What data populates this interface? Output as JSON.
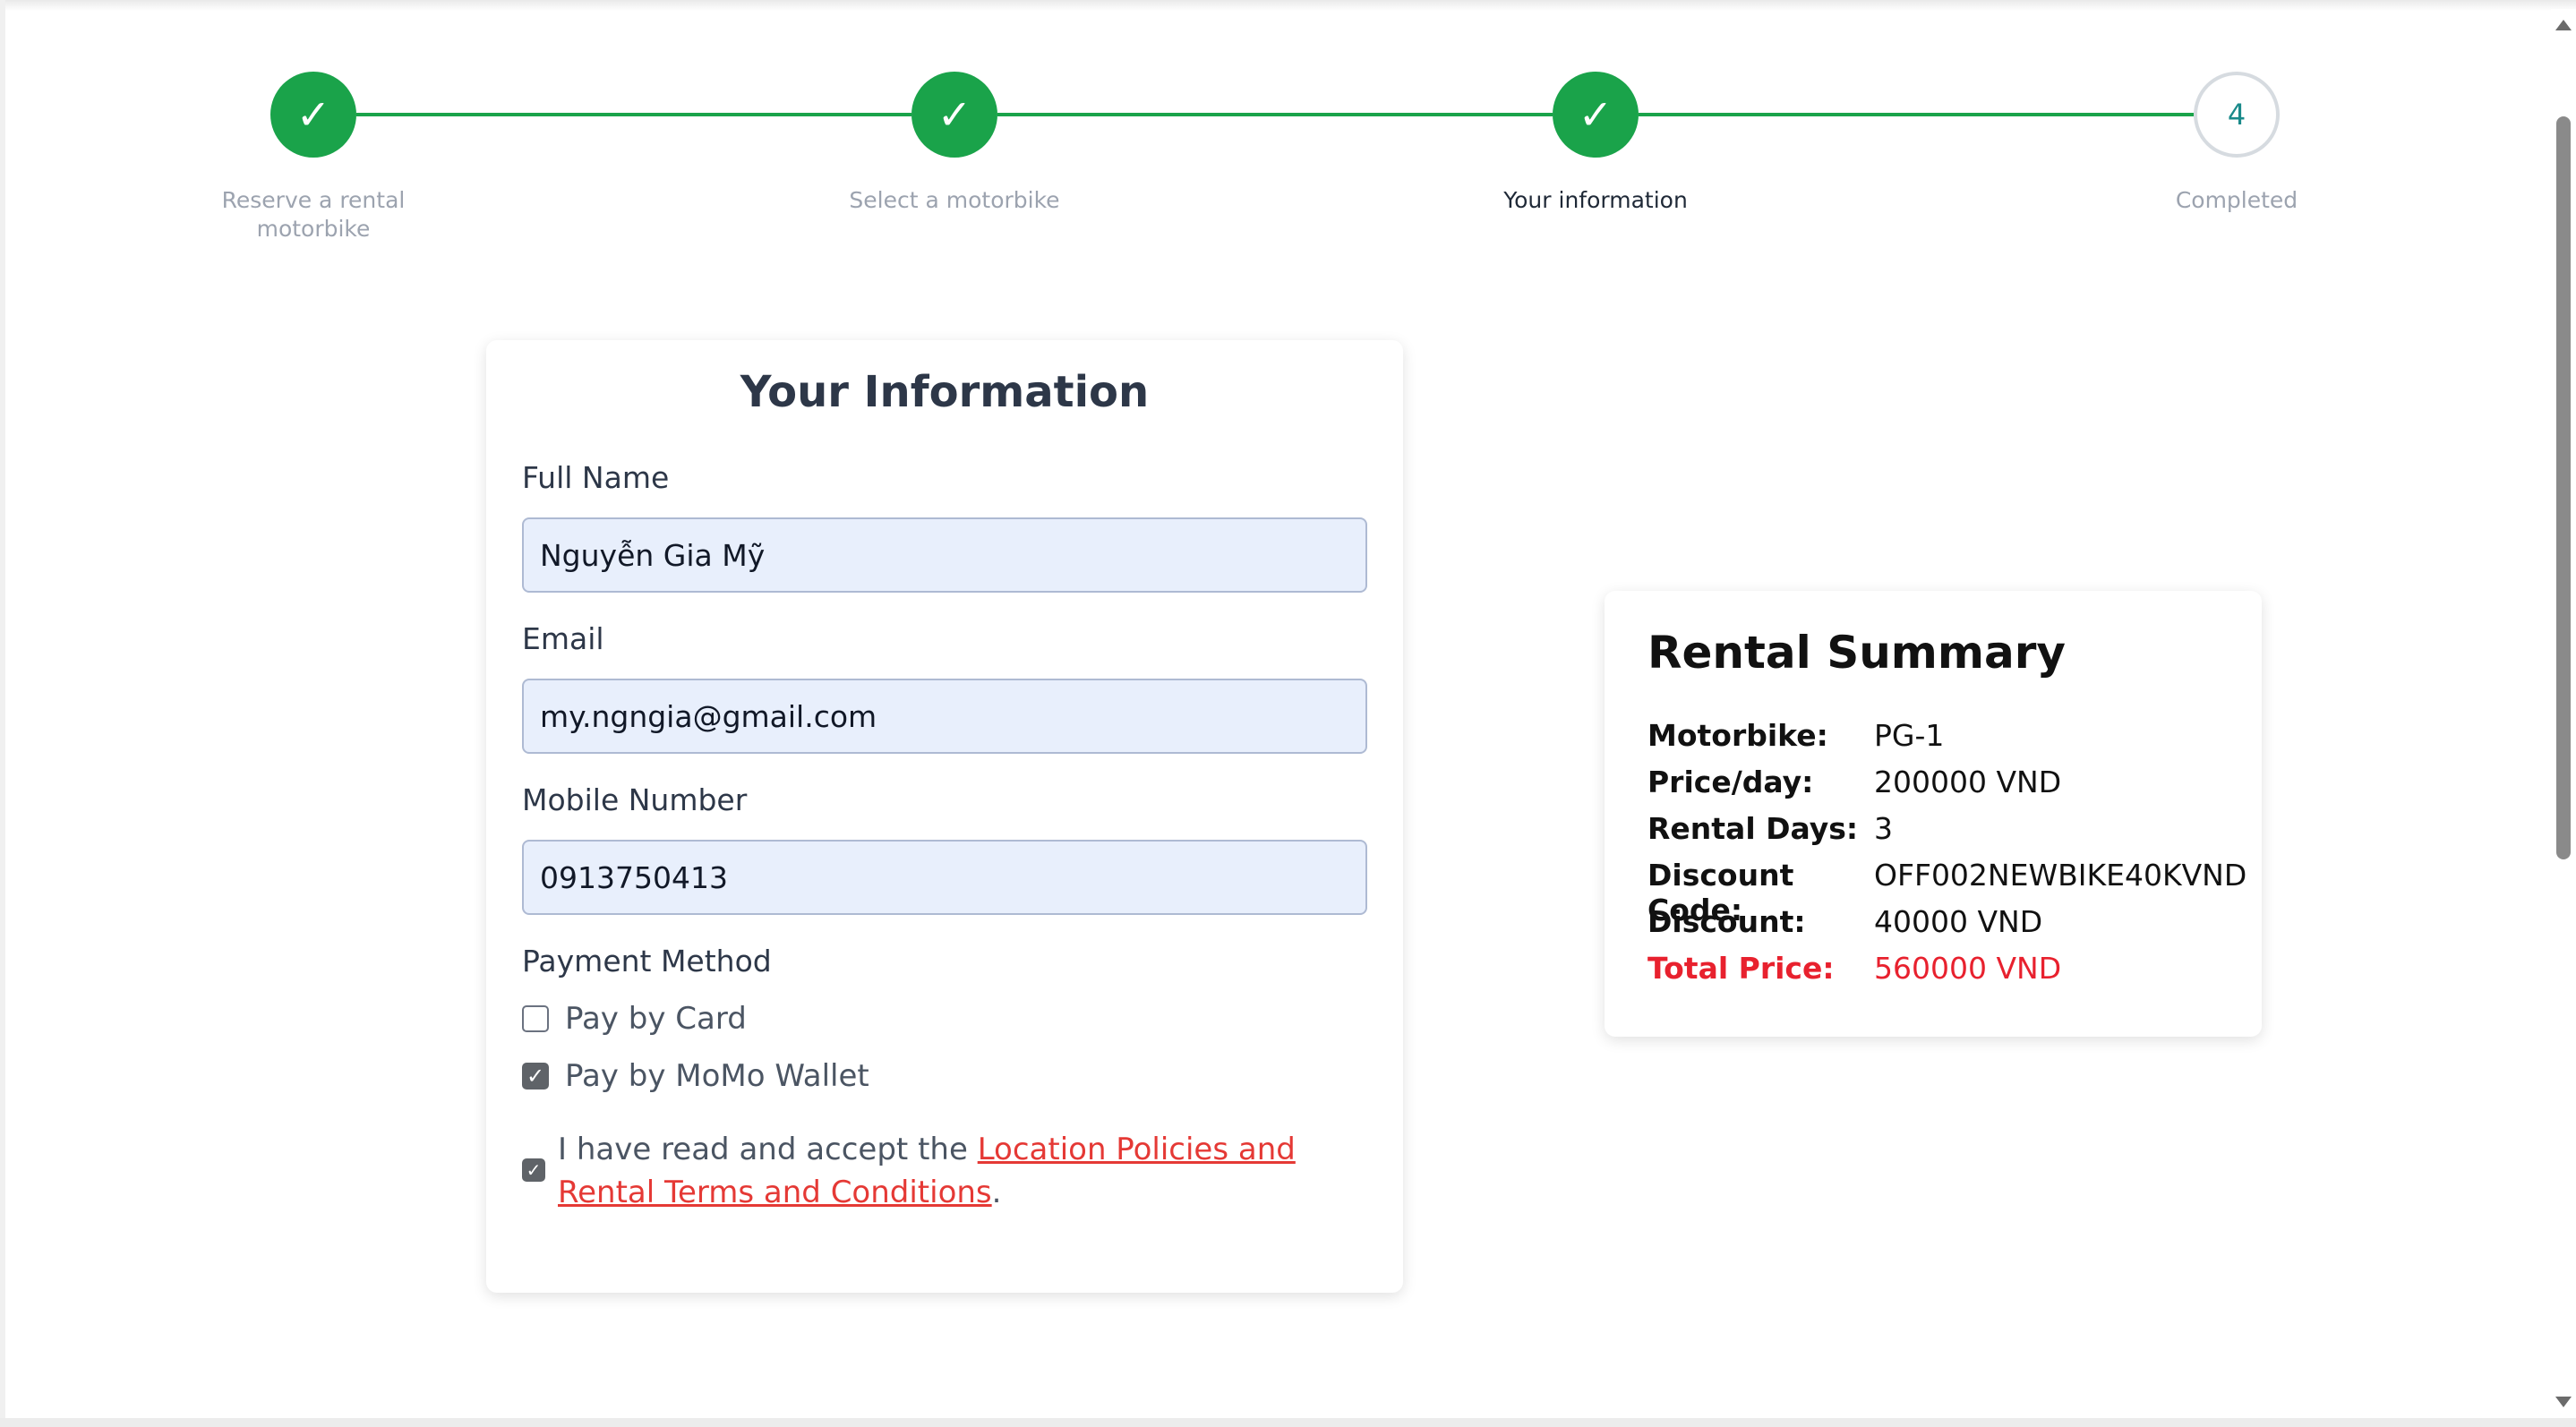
{
  "stepper": {
    "steps": [
      {
        "label": "Reserve a rental motorbike",
        "symbol": "✓",
        "state": "done"
      },
      {
        "label": "Select a motorbike",
        "symbol": "✓",
        "state": "done"
      },
      {
        "label": "Your information",
        "symbol": "✓",
        "state": "current"
      },
      {
        "label": "Completed",
        "symbol": "4",
        "state": "pending"
      }
    ],
    "accent_color": "#1aa34a"
  },
  "form": {
    "title": "Your Information",
    "full_name_label": "Full Name",
    "full_name_value": "Nguyễn Gia Mỹ",
    "email_label": "Email",
    "email_value": "my.ngngia@gmail.com",
    "mobile_label": "Mobile Number",
    "mobile_value": "0913750413",
    "payment_label": "Payment Method",
    "pay_card_label": "Pay by Card",
    "pay_card_checked": false,
    "pay_momo_label": "Pay by MoMo Wallet",
    "pay_momo_checked": true,
    "terms_prefix": "I have read and accept the ",
    "terms_link": "Location Policies and Rental Terms and Conditions",
    "terms_suffix": ".",
    "terms_checked": true
  },
  "summary": {
    "title": "Rental Summary",
    "motorbike_label": "Motorbike:",
    "motorbike_value": "PG-1",
    "price_label": "Price/day:",
    "price_value": "200000 VND",
    "days_label": "Rental Days:",
    "days_value": "3",
    "code_label": "Discount Code:",
    "code_value": "OFF002NEWBIKE40KVND",
    "discount_label": "Discount:",
    "discount_value": "40000 VND",
    "total_label": "Total Price:",
    "total_value": "560000 VND",
    "total_color": "#e8212e"
  }
}
